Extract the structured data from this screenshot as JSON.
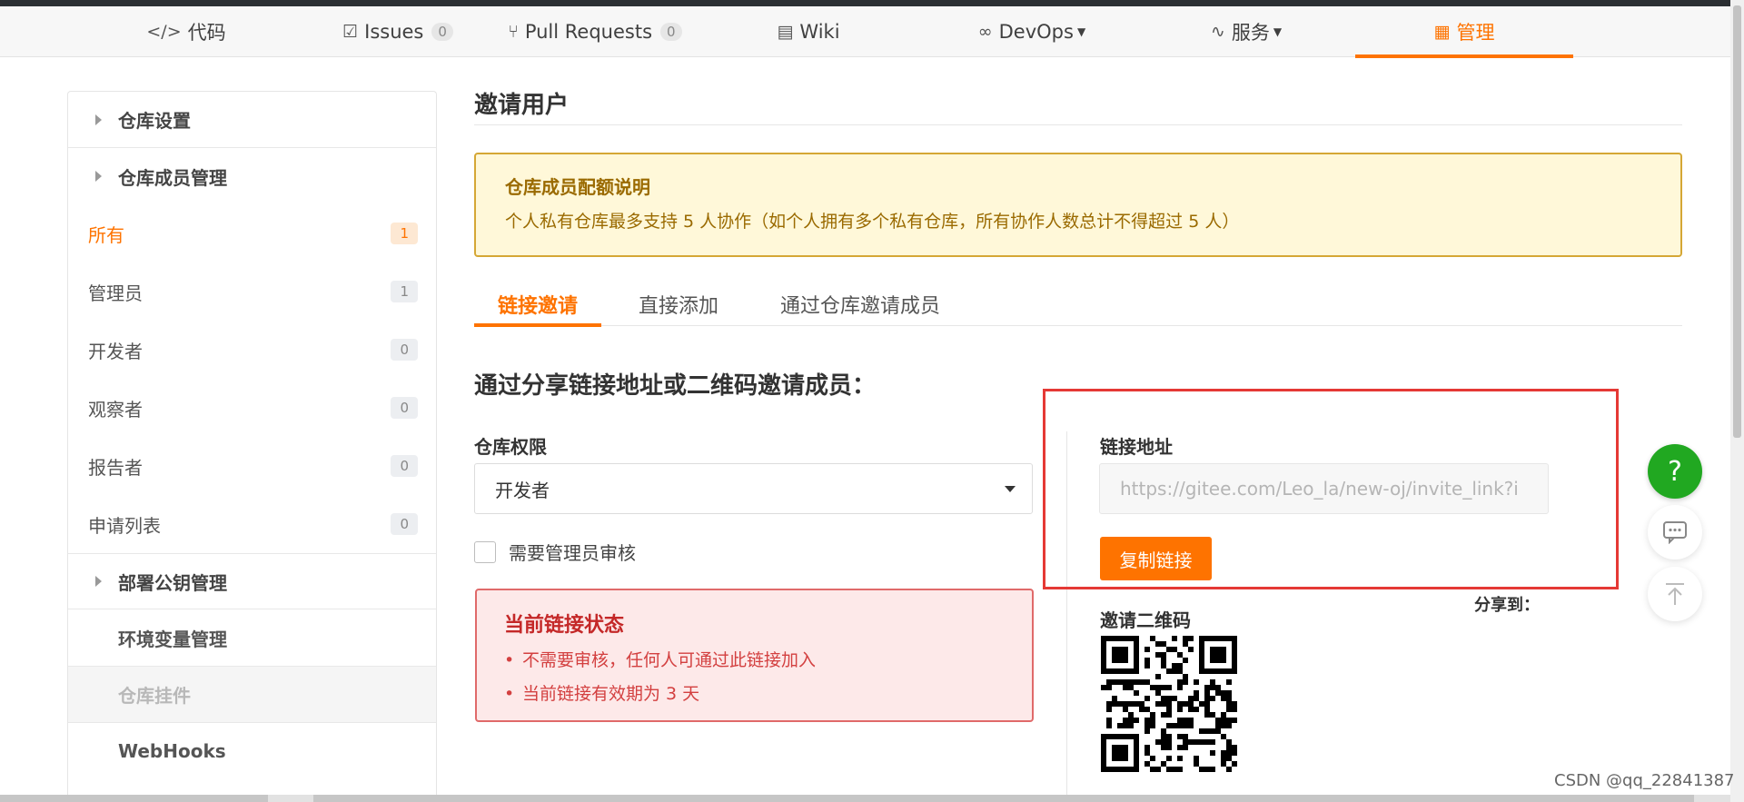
{
  "nav": {
    "items": [
      {
        "label": "代码",
        "icon": "code-icon",
        "glyph": "</>"
      },
      {
        "label": "Issues",
        "icon": "issues-icon",
        "glyph": "☑",
        "count": "0"
      },
      {
        "label": "Pull Requests",
        "icon": "pull-request-icon",
        "glyph": "⑂",
        "count": "0"
      },
      {
        "label": "Wiki",
        "icon": "wiki-icon",
        "glyph": "▤"
      },
      {
        "label": "DevOps",
        "icon": "infinity-icon",
        "glyph": "∞"
      },
      {
        "label": "服务",
        "icon": "pulse-icon",
        "glyph": "∿"
      },
      {
        "label": "管理",
        "icon": "manage-icon",
        "glyph": "▦"
      }
    ],
    "accent_color": "#fe7300"
  },
  "sidebar": {
    "repo_settings": "仓库设置",
    "member_mgmt": "仓库成员管理",
    "members": [
      {
        "label": "所有",
        "count": "1"
      },
      {
        "label": "管理员",
        "count": "1"
      },
      {
        "label": "开发者",
        "count": "0"
      },
      {
        "label": "观察者",
        "count": "0"
      },
      {
        "label": "报告者",
        "count": "0"
      },
      {
        "label": "申请列表",
        "count": "0"
      }
    ],
    "deploy_keys": "部署公钥管理",
    "env_vars": "环境变量管理",
    "plugins": "仓库挂件",
    "webhooks": "WebHooks"
  },
  "main": {
    "title": "邀请用户",
    "notice": {
      "heading": "仓库成员配额说明",
      "text": "个人私有仓库最多支持 5 人协作（如个人拥有多个私有仓库，所有协作人数总计不得超过 5 人）"
    },
    "tabs": [
      "链接邀请",
      "直接添加",
      "通过仓库邀请成员"
    ],
    "section_title": "通过分享链接地址或二维码邀请成员：",
    "permission_label": "仓库权限",
    "permission_value": "开发者",
    "require_review": "需要管理员审核",
    "status": {
      "heading": "当前链接状态",
      "items": [
        "不需要审核，任何人可通过此链接加入",
        "当前链接有效期为 3 天"
      ]
    },
    "link_label": "链接地址",
    "link_placeholder": "https://gitee.com/Leo_la/new-oj/invite_link?i",
    "copy_button": "复制链接",
    "qr_label": "邀请二维码",
    "share_label": "分享到："
  },
  "floating": {
    "help": "?"
  },
  "watermark": "CSDN @qq_22841387"
}
